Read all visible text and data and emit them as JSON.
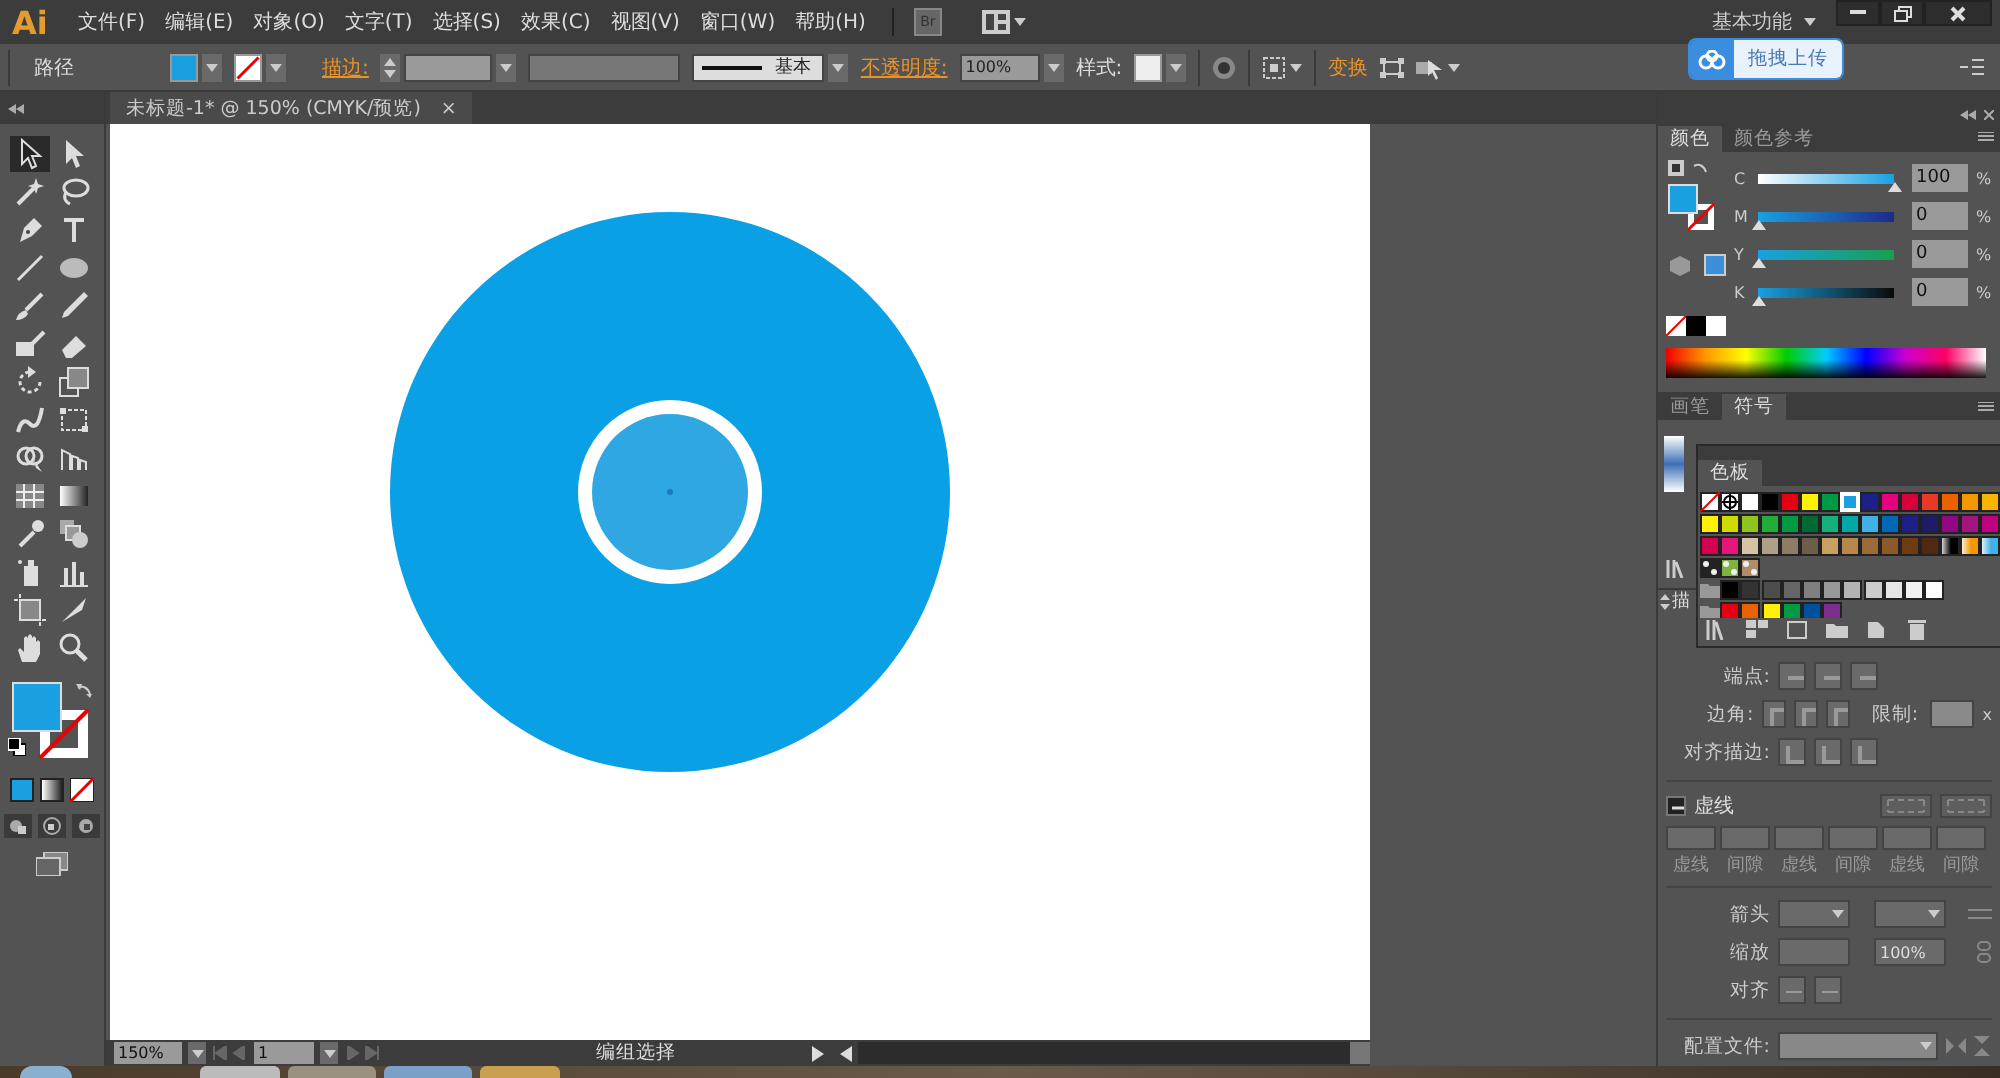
{
  "app": {
    "logo": "Ai",
    "bridge": "Br"
  },
  "menus": [
    "文件(F)",
    "编辑(E)",
    "对象(O)",
    "文字(T)",
    "选择(S)",
    "效果(C)",
    "视图(V)",
    "窗口(W)",
    "帮助(H)"
  ],
  "workspace": "基本功能",
  "upload_popup": {
    "label": "拖拽上传"
  },
  "control_bar": {
    "selection": "路径",
    "stroke_label": "描边:",
    "brush": "基本",
    "opacity_label": "不透明度:",
    "opacity": "100%",
    "style_label": "样式:",
    "transform": "变换"
  },
  "document_tab": {
    "title": "未标题-1* @ 150% (CMYK/预览)",
    "close": "×"
  },
  "tools": [
    {
      "kind": "select",
      "selected": true
    },
    {
      "kind": "direct",
      "selected": false
    },
    {
      "kind": "wand",
      "selected": false
    },
    {
      "kind": "lasso",
      "selected": false
    },
    {
      "kind": "pen",
      "selected": false
    },
    {
      "kind": "type",
      "selected": false
    },
    {
      "kind": "line",
      "selected": false
    },
    {
      "kind": "ellipse",
      "selected": false
    },
    {
      "kind": "brush",
      "selected": false
    },
    {
      "kind": "pencil",
      "selected": false
    },
    {
      "kind": "blob",
      "selected": false
    },
    {
      "kind": "eraser",
      "selected": false
    },
    {
      "kind": "rotate",
      "selected": false
    },
    {
      "kind": "scale",
      "selected": false
    },
    {
      "kind": "warp",
      "selected": false
    },
    {
      "kind": "freetransform",
      "selected": false
    },
    {
      "kind": "shapebuilder",
      "selected": false
    },
    {
      "kind": "perspective",
      "selected": false
    },
    {
      "kind": "mesh",
      "selected": false
    },
    {
      "kind": "gradient",
      "selected": false
    },
    {
      "kind": "eyedropper",
      "selected": false
    },
    {
      "kind": "blend",
      "selected": false
    },
    {
      "kind": "sprayer",
      "selected": false
    },
    {
      "kind": "graph",
      "selected": false
    },
    {
      "kind": "artboard",
      "selected": false
    },
    {
      "kind": "slice",
      "selected": false
    },
    {
      "kind": "hand",
      "selected": false
    },
    {
      "kind": "zoom",
      "selected": false
    }
  ],
  "color_panel": {
    "tabs": [
      {
        "label": "颜色",
        "selected": true
      },
      {
        "label": "颜色参考",
        "selected": false
      }
    ],
    "channels": [
      {
        "name": "C",
        "level": 1,
        "value": "100",
        "unit": "%"
      },
      {
        "name": "M",
        "level": 0,
        "value": "0",
        "unit": "%"
      },
      {
        "name": "Y",
        "level": 0,
        "value": "0",
        "unit": "%"
      },
      {
        "name": "K",
        "level": 0,
        "value": "0",
        "unit": "%"
      }
    ]
  },
  "symbols_panel": {
    "tabs": [
      {
        "label": "画笔",
        "selected": false
      },
      {
        "label": "符号",
        "selected": true
      }
    ]
  },
  "swatches_panel": {
    "tab": "色板",
    "rows": [
      [
        {
          "kind": "none",
          "selected": false
        },
        {
          "kind": "registration",
          "selected": false
        },
        {
          "kind": "color",
          "color": "#ffffff",
          "selected": false
        },
        {
          "kind": "color",
          "color": "#000000",
          "selected": false
        },
        {
          "kind": "color",
          "color": "#e60012",
          "selected": false
        },
        {
          "kind": "color",
          "color": "#fff100",
          "selected": false
        },
        {
          "kind": "color",
          "color": "#009944",
          "selected": false
        },
        {
          "kind": "color",
          "color": "#1aa0e0",
          "selected": true
        },
        {
          "kind": "color",
          "color": "#1d2088",
          "selected": false
        },
        {
          "kind": "color",
          "color": "#e4007f",
          "selected": false
        },
        {
          "kind": "color",
          "color": "#d7003a",
          "selected": false
        },
        {
          "kind": "color",
          "color": "#e83828",
          "selected": false
        },
        {
          "kind": "color",
          "color": "#eb6100",
          "selected": false
        },
        {
          "kind": "color",
          "color": "#f39800",
          "selected": false
        },
        {
          "kind": "color",
          "color": "#f8b500",
          "selected": false
        }
      ],
      [
        {
          "kind": "color",
          "color": "#fff100",
          "selected": false
        },
        {
          "kind": "color",
          "color": "#cfdb00",
          "selected": false
        },
        {
          "kind": "color",
          "color": "#8fc31f",
          "selected": false
        },
        {
          "kind": "color",
          "color": "#22ac38",
          "selected": false
        },
        {
          "kind": "color",
          "color": "#009944",
          "selected": false
        },
        {
          "kind": "color",
          "color": "#006934",
          "selected": false
        },
        {
          "kind": "color",
          "color": "#16b07d",
          "selected": false
        },
        {
          "kind": "color",
          "color": "#00a9a6",
          "selected": false
        },
        {
          "kind": "color",
          "color": "#3fb1e6",
          "selected": false
        },
        {
          "kind": "color",
          "color": "#0068b7",
          "selected": false
        },
        {
          "kind": "color",
          "color": "#1d2088",
          "selected": false
        },
        {
          "kind": "color",
          "color": "#1f1b68",
          "selected": false
        },
        {
          "kind": "color",
          "color": "#920783",
          "selected": false
        },
        {
          "kind": "color",
          "color": "#a4167f",
          "selected": false
        },
        {
          "kind": "color",
          "color": "#be0081",
          "selected": false
        }
      ],
      [
        {
          "kind": "color",
          "color": "#d7004f",
          "selected": false
        },
        {
          "kind": "color",
          "color": "#e5157a",
          "selected": false
        },
        {
          "kind": "color",
          "color": "#d4c4a3",
          "selected": false
        },
        {
          "kind": "color",
          "color": "#ae9f87",
          "selected": false
        },
        {
          "kind": "color",
          "color": "#8c7d67",
          "selected": false
        },
        {
          "kind": "color",
          "color": "#6e5d4a",
          "selected": false
        },
        {
          "kind": "color",
          "color": "#c9a063",
          "selected": false
        },
        {
          "kind": "color",
          "color": "#b7874e",
          "selected": false
        },
        {
          "kind": "color",
          "color": "#9b6a36",
          "selected": false
        },
        {
          "kind": "color",
          "color": "#8a5a2b",
          "selected": false
        },
        {
          "kind": "color",
          "color": "#6e3b12",
          "selected": false
        },
        {
          "kind": "color",
          "color": "#4e2a12",
          "selected": false
        },
        {
          "kind": "gradient",
          "color": "#000000",
          "selected": false
        },
        {
          "kind": "gradient",
          "color": "#f39800",
          "selected": false
        },
        {
          "kind": "gradient",
          "color": "#3fb1e6",
          "selected": false
        }
      ],
      [
        {
          "kind": "pattern",
          "color": "#222222",
          "selected": false
        },
        {
          "kind": "pattern",
          "color": "#7fb33f",
          "selected": false
        },
        {
          "kind": "pattern",
          "color": "#b08d6a",
          "selected": false
        }
      ],
      [
        {
          "kind": "folder",
          "selected": false
        },
        {
          "kind": "color",
          "color": "#000000",
          "selected": false
        },
        {
          "kind": "color",
          "color": "#333333",
          "selected": false
        },
        {
          "kind": "color",
          "color": "#4d4d4d",
          "selected": false
        },
        {
          "kind": "color",
          "color": "#666666",
          "selected": false
        },
        {
          "kind": "color",
          "color": "#808080",
          "selected": false
        },
        {
          "kind": "color",
          "color": "#999999",
          "selected": false
        },
        {
          "kind": "color",
          "color": "#b3b3b3",
          "selected": false
        },
        {
          "kind": "color",
          "color": "#cccccc",
          "selected": false
        },
        {
          "kind": "color",
          "color": "#e6e6e6",
          "selected": false
        },
        {
          "kind": "color",
          "color": "#f2f2f2",
          "selected": false
        },
        {
          "kind": "color",
          "color": "#ffffff",
          "selected": false
        }
      ],
      [
        {
          "kind": "folder",
          "selected": false
        },
        {
          "kind": "color",
          "color": "#e60012",
          "selected": false
        },
        {
          "kind": "color",
          "color": "#eb6100",
          "selected": false
        },
        {
          "kind": "color",
          "color": "#fff100",
          "selected": false
        },
        {
          "kind": "color",
          "color": "#009944",
          "selected": false
        },
        {
          "kind": "color",
          "color": "#0050a0",
          "selected": false
        },
        {
          "kind": "color",
          "color": "#7d2d8e",
          "selected": false
        }
      ]
    ]
  },
  "stroke_panel": {
    "tab": "描",
    "cap_label": "端点:",
    "corner_label": "边角:",
    "limit_label": "限制:",
    "limit_unit": "x",
    "align_label": "对齐描边:",
    "dashed": {
      "label": "虚线",
      "expanded": true
    },
    "dash_labels": [
      "虚线",
      "间隙",
      "虚线",
      "间隙",
      "虚线",
      "间隙"
    ],
    "arrow_label": "箭头",
    "scale_label": "缩放",
    "scale_value": "100%",
    "arrow_align_label": "对齐",
    "profile_label": "配置文件:"
  },
  "status_bar": {
    "zoom": "150%",
    "artboard": "1",
    "tool": "编组选择"
  }
}
